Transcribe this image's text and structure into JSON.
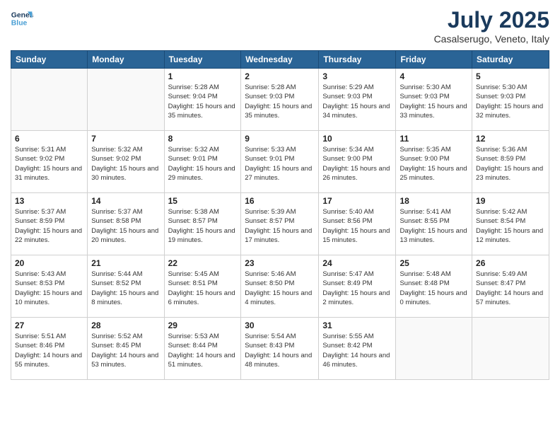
{
  "header": {
    "logo_line1": "General",
    "logo_line2": "Blue",
    "month_title": "July 2025",
    "location": "Casalserugo, Veneto, Italy"
  },
  "weekdays": [
    "Sunday",
    "Monday",
    "Tuesday",
    "Wednesday",
    "Thursday",
    "Friday",
    "Saturday"
  ],
  "weeks": [
    [
      {
        "day": "",
        "info": ""
      },
      {
        "day": "",
        "info": ""
      },
      {
        "day": "1",
        "info": "Sunrise: 5:28 AM\nSunset: 9:04 PM\nDaylight: 15 hours\nand 35 minutes."
      },
      {
        "day": "2",
        "info": "Sunrise: 5:28 AM\nSunset: 9:03 PM\nDaylight: 15 hours\nand 35 minutes."
      },
      {
        "day": "3",
        "info": "Sunrise: 5:29 AM\nSunset: 9:03 PM\nDaylight: 15 hours\nand 34 minutes."
      },
      {
        "day": "4",
        "info": "Sunrise: 5:30 AM\nSunset: 9:03 PM\nDaylight: 15 hours\nand 33 minutes."
      },
      {
        "day": "5",
        "info": "Sunrise: 5:30 AM\nSunset: 9:03 PM\nDaylight: 15 hours\nand 32 minutes."
      }
    ],
    [
      {
        "day": "6",
        "info": "Sunrise: 5:31 AM\nSunset: 9:02 PM\nDaylight: 15 hours\nand 31 minutes."
      },
      {
        "day": "7",
        "info": "Sunrise: 5:32 AM\nSunset: 9:02 PM\nDaylight: 15 hours\nand 30 minutes."
      },
      {
        "day": "8",
        "info": "Sunrise: 5:32 AM\nSunset: 9:01 PM\nDaylight: 15 hours\nand 29 minutes."
      },
      {
        "day": "9",
        "info": "Sunrise: 5:33 AM\nSunset: 9:01 PM\nDaylight: 15 hours\nand 27 minutes."
      },
      {
        "day": "10",
        "info": "Sunrise: 5:34 AM\nSunset: 9:00 PM\nDaylight: 15 hours\nand 26 minutes."
      },
      {
        "day": "11",
        "info": "Sunrise: 5:35 AM\nSunset: 9:00 PM\nDaylight: 15 hours\nand 25 minutes."
      },
      {
        "day": "12",
        "info": "Sunrise: 5:36 AM\nSunset: 8:59 PM\nDaylight: 15 hours\nand 23 minutes."
      }
    ],
    [
      {
        "day": "13",
        "info": "Sunrise: 5:37 AM\nSunset: 8:59 PM\nDaylight: 15 hours\nand 22 minutes."
      },
      {
        "day": "14",
        "info": "Sunrise: 5:37 AM\nSunset: 8:58 PM\nDaylight: 15 hours\nand 20 minutes."
      },
      {
        "day": "15",
        "info": "Sunrise: 5:38 AM\nSunset: 8:57 PM\nDaylight: 15 hours\nand 19 minutes."
      },
      {
        "day": "16",
        "info": "Sunrise: 5:39 AM\nSunset: 8:57 PM\nDaylight: 15 hours\nand 17 minutes."
      },
      {
        "day": "17",
        "info": "Sunrise: 5:40 AM\nSunset: 8:56 PM\nDaylight: 15 hours\nand 15 minutes."
      },
      {
        "day": "18",
        "info": "Sunrise: 5:41 AM\nSunset: 8:55 PM\nDaylight: 15 hours\nand 13 minutes."
      },
      {
        "day": "19",
        "info": "Sunrise: 5:42 AM\nSunset: 8:54 PM\nDaylight: 15 hours\nand 12 minutes."
      }
    ],
    [
      {
        "day": "20",
        "info": "Sunrise: 5:43 AM\nSunset: 8:53 PM\nDaylight: 15 hours\nand 10 minutes."
      },
      {
        "day": "21",
        "info": "Sunrise: 5:44 AM\nSunset: 8:52 PM\nDaylight: 15 hours\nand 8 minutes."
      },
      {
        "day": "22",
        "info": "Sunrise: 5:45 AM\nSunset: 8:51 PM\nDaylight: 15 hours\nand 6 minutes."
      },
      {
        "day": "23",
        "info": "Sunrise: 5:46 AM\nSunset: 8:50 PM\nDaylight: 15 hours\nand 4 minutes."
      },
      {
        "day": "24",
        "info": "Sunrise: 5:47 AM\nSunset: 8:49 PM\nDaylight: 15 hours\nand 2 minutes."
      },
      {
        "day": "25",
        "info": "Sunrise: 5:48 AM\nSunset: 8:48 PM\nDaylight: 15 hours\nand 0 minutes."
      },
      {
        "day": "26",
        "info": "Sunrise: 5:49 AM\nSunset: 8:47 PM\nDaylight: 14 hours\nand 57 minutes."
      }
    ],
    [
      {
        "day": "27",
        "info": "Sunrise: 5:51 AM\nSunset: 8:46 PM\nDaylight: 14 hours\nand 55 minutes."
      },
      {
        "day": "28",
        "info": "Sunrise: 5:52 AM\nSunset: 8:45 PM\nDaylight: 14 hours\nand 53 minutes."
      },
      {
        "day": "29",
        "info": "Sunrise: 5:53 AM\nSunset: 8:44 PM\nDaylight: 14 hours\nand 51 minutes."
      },
      {
        "day": "30",
        "info": "Sunrise: 5:54 AM\nSunset: 8:43 PM\nDaylight: 14 hours\nand 48 minutes."
      },
      {
        "day": "31",
        "info": "Sunrise: 5:55 AM\nSunset: 8:42 PM\nDaylight: 14 hours\nand 46 minutes."
      },
      {
        "day": "",
        "info": ""
      },
      {
        "day": "",
        "info": ""
      }
    ]
  ]
}
